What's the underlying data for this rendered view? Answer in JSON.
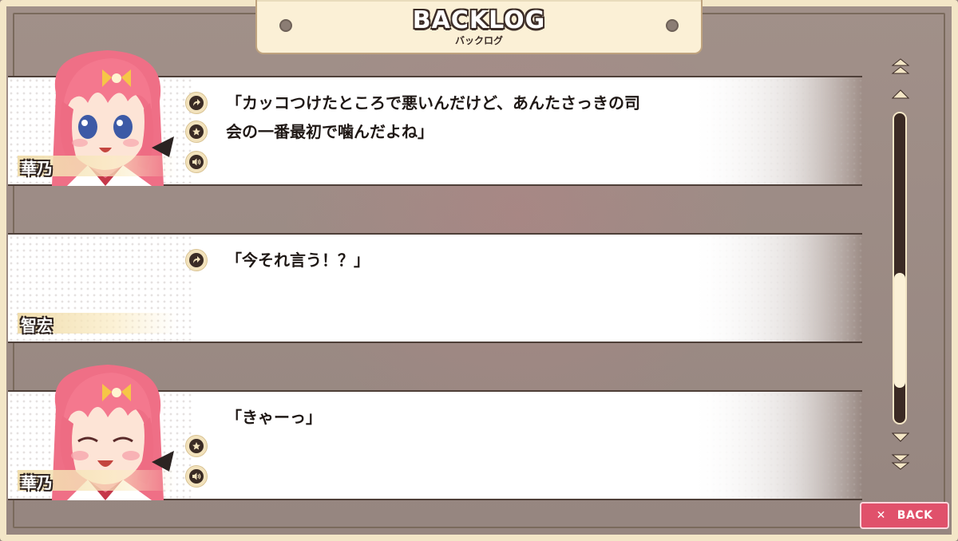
{
  "header": {
    "title": "BACKLOG",
    "subtitle": "バックログ"
  },
  "entries": [
    {
      "speaker": "華乃",
      "has_portrait": true,
      "portrait_expression": "talking",
      "buttons": [
        "jump-icon",
        "star-icon",
        "voice-icon"
      ],
      "lines": [
        "「カッコつけたところで悪いんだけど、あんたさっきの司",
        "会の一番最初で噛んだよね」"
      ]
    },
    {
      "speaker": "智宏",
      "has_portrait": false,
      "buttons": [
        "jump-icon"
      ],
      "lines": [
        "「今それ言う！？」"
      ]
    },
    {
      "speaker": "華乃",
      "has_portrait": true,
      "portrait_expression": "eyes-closed",
      "buttons": [
        "star-icon",
        "voice-icon"
      ],
      "lines": [
        "「きゃーっ」"
      ]
    }
  ],
  "scrollbar": {
    "position": 0.82
  },
  "back_button": {
    "label": "BACK",
    "icon": "close-icon"
  },
  "colors": {
    "frame": "#f3e6c7",
    "back_button": "#e0516b",
    "text": "#1f1815",
    "hair": "#f07a8e"
  }
}
